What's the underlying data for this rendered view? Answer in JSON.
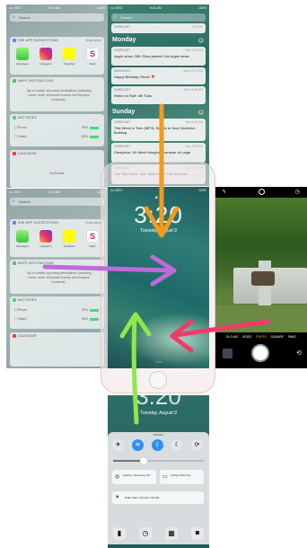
{
  "status": {
    "carrier": "•••• EEO",
    "time": "9:41 AM",
    "battery": "100%"
  },
  "search": {
    "placeholder": "Search"
  },
  "widgets": {
    "siri_apps": {
      "title": "SIRI APP SUGGESTIONS",
      "action": "Show More",
      "apps": [
        "Messages",
        "Instagram",
        "Snapchat",
        "Slack"
      ]
    },
    "maps_destinations": {
      "title": "MAPS DESTINATIONS",
      "body": "Tap to enable upcoming destinations (including home, work, scheduled events and frequent locations)."
    },
    "batteries": {
      "title": "BATTERIES",
      "rows": [
        {
          "device": "iPhone",
          "value": "99%"
        },
        {
          "device": "Watch",
          "value": "80%"
        }
      ]
    },
    "calendar": {
      "title": "CALENDAR",
      "body": "No Events"
    }
  },
  "notifications": {
    "top_item": {
      "app": "OVERCAST",
      "body": "Episode 1",
      "time": "6:12 PM"
    },
    "sections": [
      {
        "day": "Monday",
        "items": [
          {
            "app": "OVERCAST",
            "time": "Mon 7:50 PM",
            "body": "Apple show: 289: Slow jammin' the Apple news"
          },
          {
            "app": "MESSAGES",
            "time": "Mon 12:17 PM",
            "body": "Happy Birthday, Rene! 🎈"
          },
          {
            "app": "OVERCAST",
            "time": "Mon 10:48 PM",
            "body": "Rebel vs Fluff: 4th Tues"
          }
        ]
      },
      {
        "day": "Sunday",
        "items": [
          {
            "app": "OVERCAST",
            "time": "Sun 4:50 PM",
            "body": "This Week in Tech (MP3): Scrolls to Very Vindictive Building"
          },
          {
            "app": "OVERCAST",
            "time": "Sun 3:58 PM",
            "body": "Disruption: 16: Meet Hongbo Character of Large"
          },
          {
            "app": "OVERCAST",
            "time": "Sun 2:17 PM",
            "body": "The Talk Show: 169: Walk Down The Beautiful"
          }
        ]
      }
    ]
  },
  "lock_screen": {
    "time": "3:20",
    "date": "Tuesday, August 9",
    "carrier": "•••• EEO",
    "battery": "100%"
  },
  "lock_screen_bottom": {
    "time": "3:20",
    "date": "Tuesday, August 9"
  },
  "camera": {
    "modes": [
      "SLO-MO",
      "VIDEO",
      "PHOTO",
      "SQUARE",
      "PANO"
    ],
    "active_mode": "PHOTO"
  },
  "control_center": {
    "airdrop": "AirDrop: Receiving Off",
    "airplay": "AirPlay Mirroring",
    "night_shift": "Night Shift: Off Until 7:00 PM"
  },
  "colors": {
    "arrow_orange": "#f59a1c",
    "arrow_purple": "#c06ad9",
    "arrow_pink": "#ee3c6a",
    "arrow_green": "#8fe84a",
    "toggle_blue": "#2f8ff5"
  }
}
